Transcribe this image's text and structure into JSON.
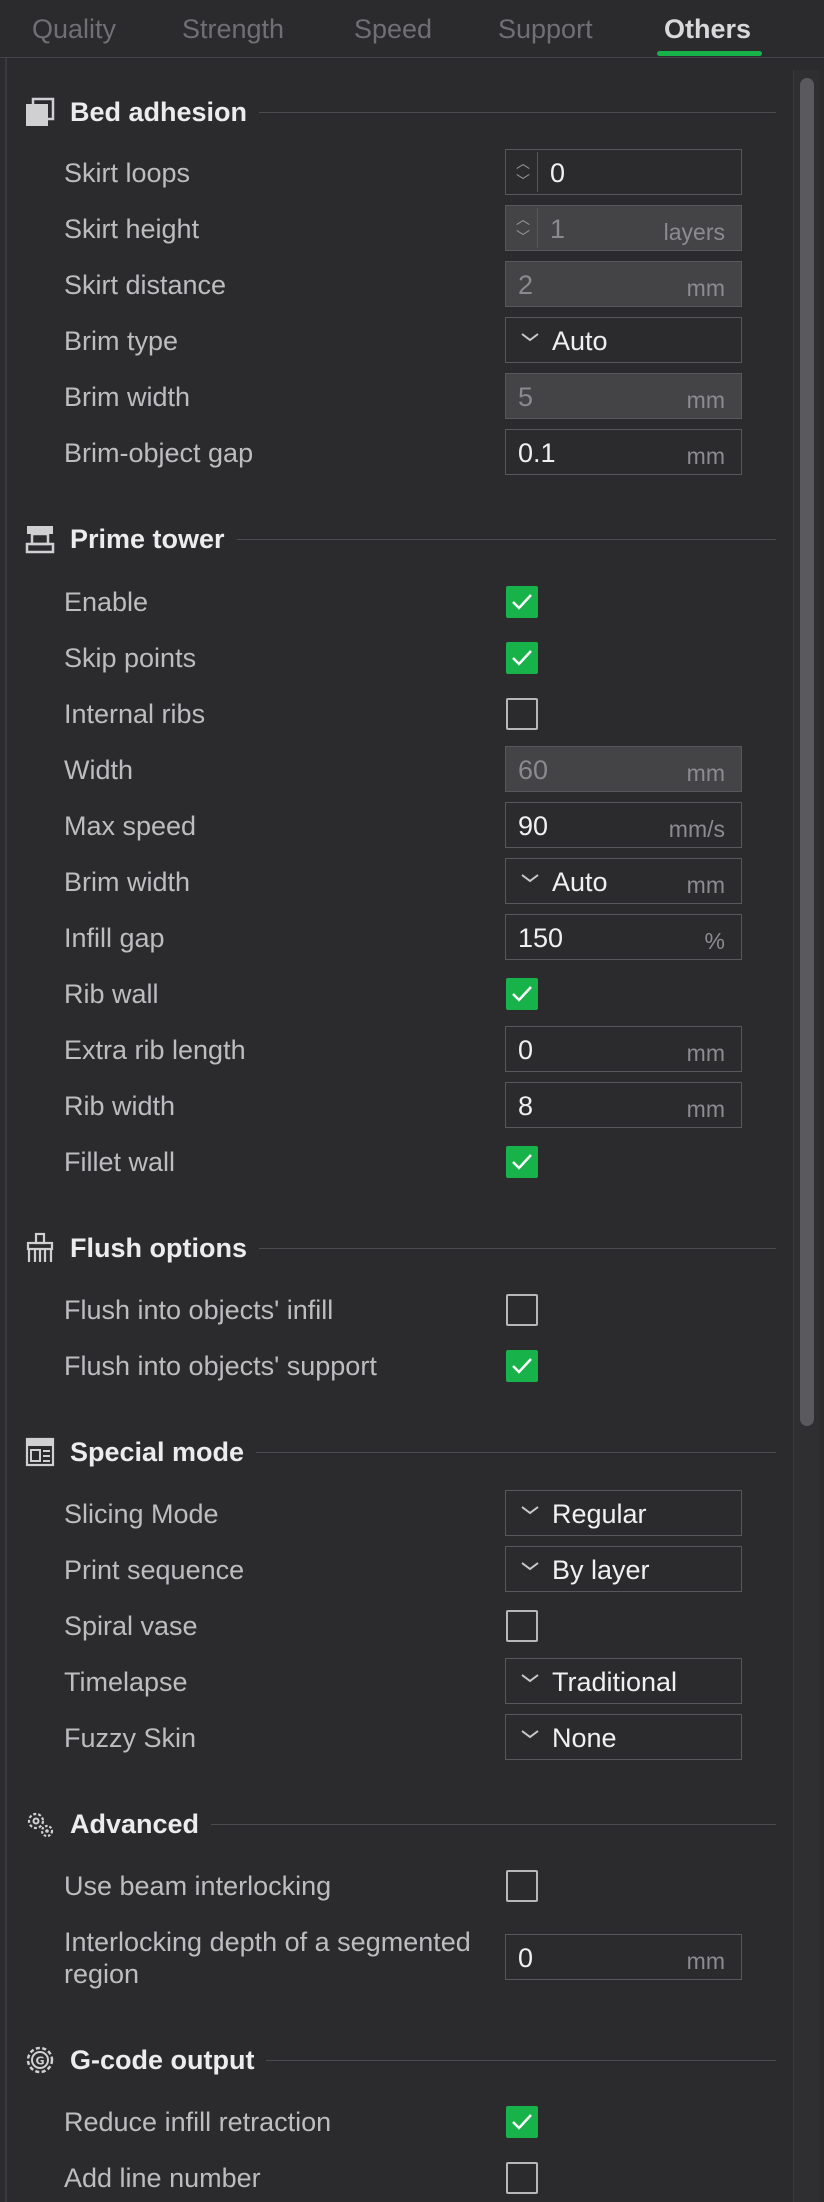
{
  "tabs": [
    "Quality",
    "Strength",
    "Speed",
    "Support",
    "Others"
  ],
  "active_tab": "Others",
  "colors": {
    "accent": "#17b34a",
    "background": "#2b2b2e",
    "disabled_field": "#444447"
  },
  "bed_adhesion": {
    "title": "Bed adhesion",
    "icon": "bed-adhesion-icon",
    "skirt_loops": {
      "label": "Skirt loops",
      "value": "0"
    },
    "skirt_height": {
      "label": "Skirt height",
      "value": "1",
      "unit": "layers"
    },
    "skirt_distance": {
      "label": "Skirt distance",
      "value": "2",
      "unit": "mm"
    },
    "brim_type": {
      "label": "Brim type",
      "value": "Auto"
    },
    "brim_width": {
      "label": "Brim width",
      "value": "5",
      "unit": "mm"
    },
    "brim_object_gap": {
      "label": "Brim-object gap",
      "value": "0.1",
      "unit": "mm"
    }
  },
  "prime_tower": {
    "title": "Prime tower",
    "icon": "prime-tower-icon",
    "enable": {
      "label": "Enable",
      "checked": true
    },
    "skip_points": {
      "label": "Skip points",
      "checked": true
    },
    "internal_ribs": {
      "label": "Internal ribs",
      "checked": false
    },
    "width": {
      "label": "Width",
      "value": "60",
      "unit": "mm"
    },
    "max_speed": {
      "label": "Max speed",
      "value": "90",
      "unit": "mm/s"
    },
    "brim_width": {
      "label": "Brim width",
      "value": "Auto",
      "unit": "mm"
    },
    "infill_gap": {
      "label": "Infill gap",
      "value": "150",
      "unit": "%"
    },
    "rib_wall": {
      "label": "Rib wall",
      "checked": true
    },
    "extra_rib_length": {
      "label": "Extra rib length",
      "value": "0",
      "unit": "mm"
    },
    "rib_width": {
      "label": "Rib width",
      "value": "8",
      "unit": "mm"
    },
    "fillet_wall": {
      "label": "Fillet wall",
      "checked": true
    }
  },
  "flush_options": {
    "title": "Flush options",
    "icon": "flush-brush-icon",
    "flush_infill": {
      "label": "Flush into objects' infill",
      "checked": false
    },
    "flush_support": {
      "label": "Flush into objects' support",
      "checked": true
    }
  },
  "special_mode": {
    "title": "Special mode",
    "icon": "special-mode-icon",
    "slicing_mode": {
      "label": "Slicing Mode",
      "value": "Regular"
    },
    "print_sequence": {
      "label": "Print sequence",
      "value": "By layer"
    },
    "spiral_vase": {
      "label": "Spiral vase",
      "checked": false
    },
    "timelapse": {
      "label": "Timelapse",
      "value": "Traditional"
    },
    "fuzzy_skin": {
      "label": "Fuzzy Skin",
      "value": "None"
    }
  },
  "advanced": {
    "title": "Advanced",
    "icon": "advanced-gears-icon",
    "beam_interlocking": {
      "label": "Use beam interlocking",
      "checked": false
    },
    "interlocking_depth": {
      "label": "Interlocking depth of a segmented region",
      "value": "0",
      "unit": "mm"
    }
  },
  "gcode_output": {
    "title": "G-code output",
    "icon": "gcode-gear-icon",
    "reduce_infill_retraction": {
      "label": "Reduce infill retraction",
      "checked": true
    },
    "add_line_number": {
      "label": "Add line number",
      "checked": false
    }
  }
}
